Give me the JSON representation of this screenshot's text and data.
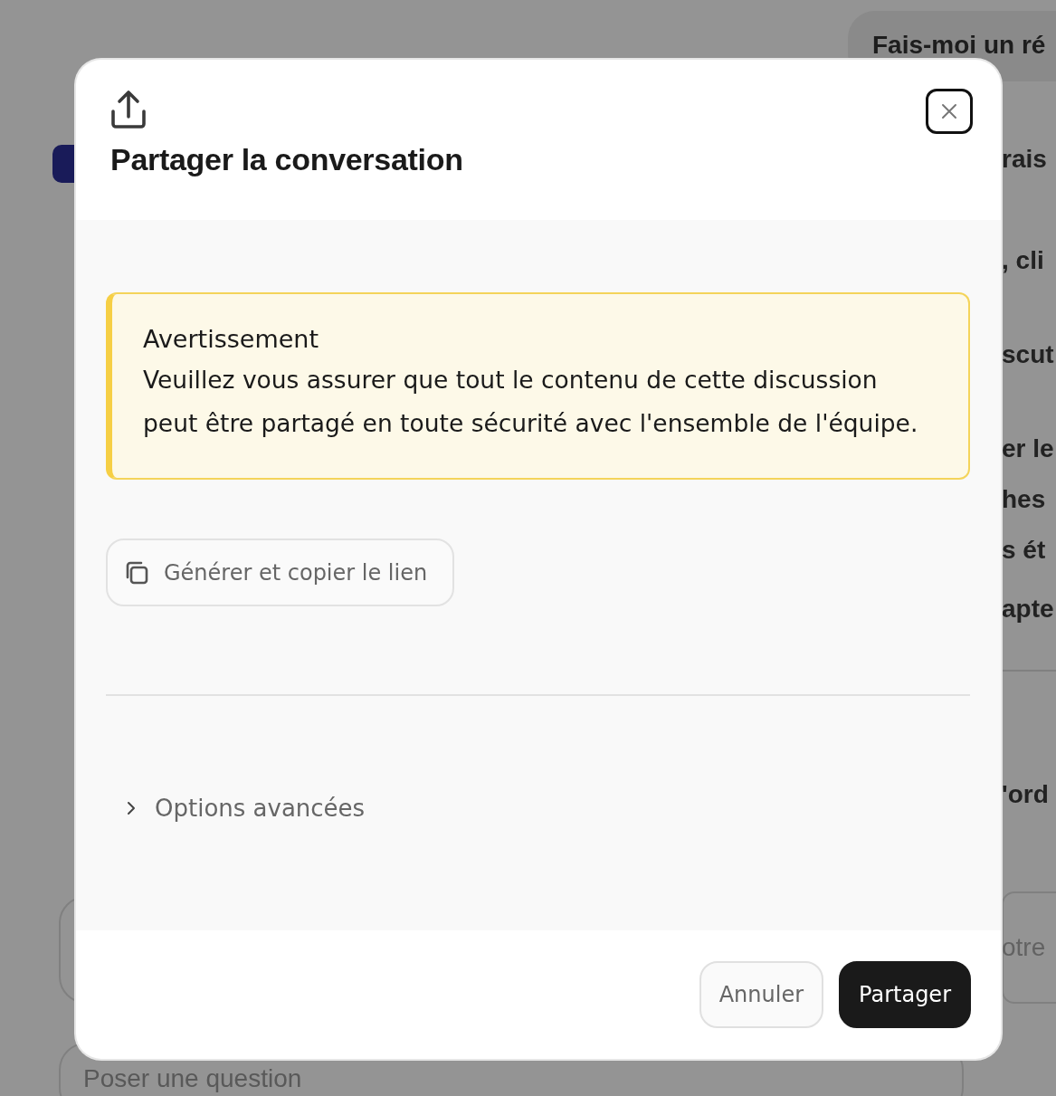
{
  "background": {
    "suggestion": "Fais-moi un ré",
    "fragments": [
      "rais",
      ", cli",
      "scut",
      "er le",
      "hes",
      "s ét",
      "apte",
      "'ord"
    ],
    "input_fragment": "otre",
    "question_field": {
      "placeholder": "Poser une question"
    }
  },
  "dialog": {
    "title": "Partager la conversation",
    "warning": {
      "title": "Avertissement",
      "text": "Veuillez vous assurer que tout le contenu de cette discussion peut être partagé en toute sécurité avec l'ensemble de l'équipe."
    },
    "copy_link_button": "Générer et copier le lien",
    "advanced": {
      "label": "Options avancées",
      "expanded": false
    },
    "buttons": [
      {
        "label": "Annuler",
        "kind": "secondary"
      },
      {
        "label": "Partager",
        "kind": "primary"
      }
    ]
  }
}
